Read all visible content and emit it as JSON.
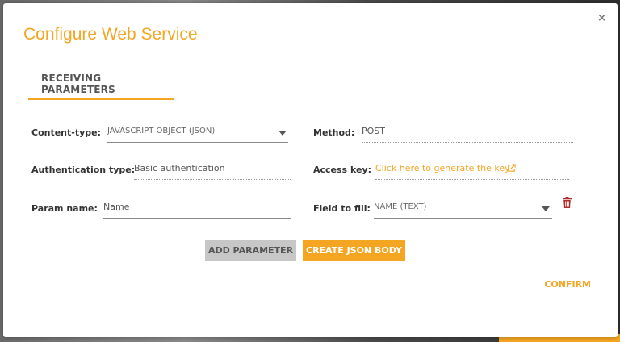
{
  "dialog": {
    "title": "Configure Web Service",
    "close_glyph": "×"
  },
  "tabs": [
    {
      "label": "RECEIVING PARAMETERS",
      "active": true
    }
  ],
  "form": {
    "content_type": {
      "label": "Content-type:",
      "value": "JAVASCRIPT OBJECT (JSON)"
    },
    "method": {
      "label": "Method:",
      "value": "POST"
    },
    "auth_type": {
      "label": "Authentication type:",
      "value": "Basic authentication"
    },
    "access_key": {
      "label": "Access key:",
      "link_text": "Click here to generate the key"
    },
    "param_name": {
      "label": "Param name:",
      "value": "Name"
    },
    "field_to_fill": {
      "label": "Field to fill:",
      "value": "NAME (TEXT)"
    }
  },
  "buttons": {
    "add_parameter": "ADD PARAMETER",
    "create_json_body": "CREATE JSON BODY",
    "confirm": "CONFIRM"
  },
  "icons": {
    "close": "close-icon",
    "dropdown": "chevron-down-icon",
    "external_link": "external-link-icon",
    "delete": "trash-icon"
  },
  "colors": {
    "accent": "#f4a623",
    "delete": "#b52a2a",
    "button_grey": "#c7c7c7"
  }
}
